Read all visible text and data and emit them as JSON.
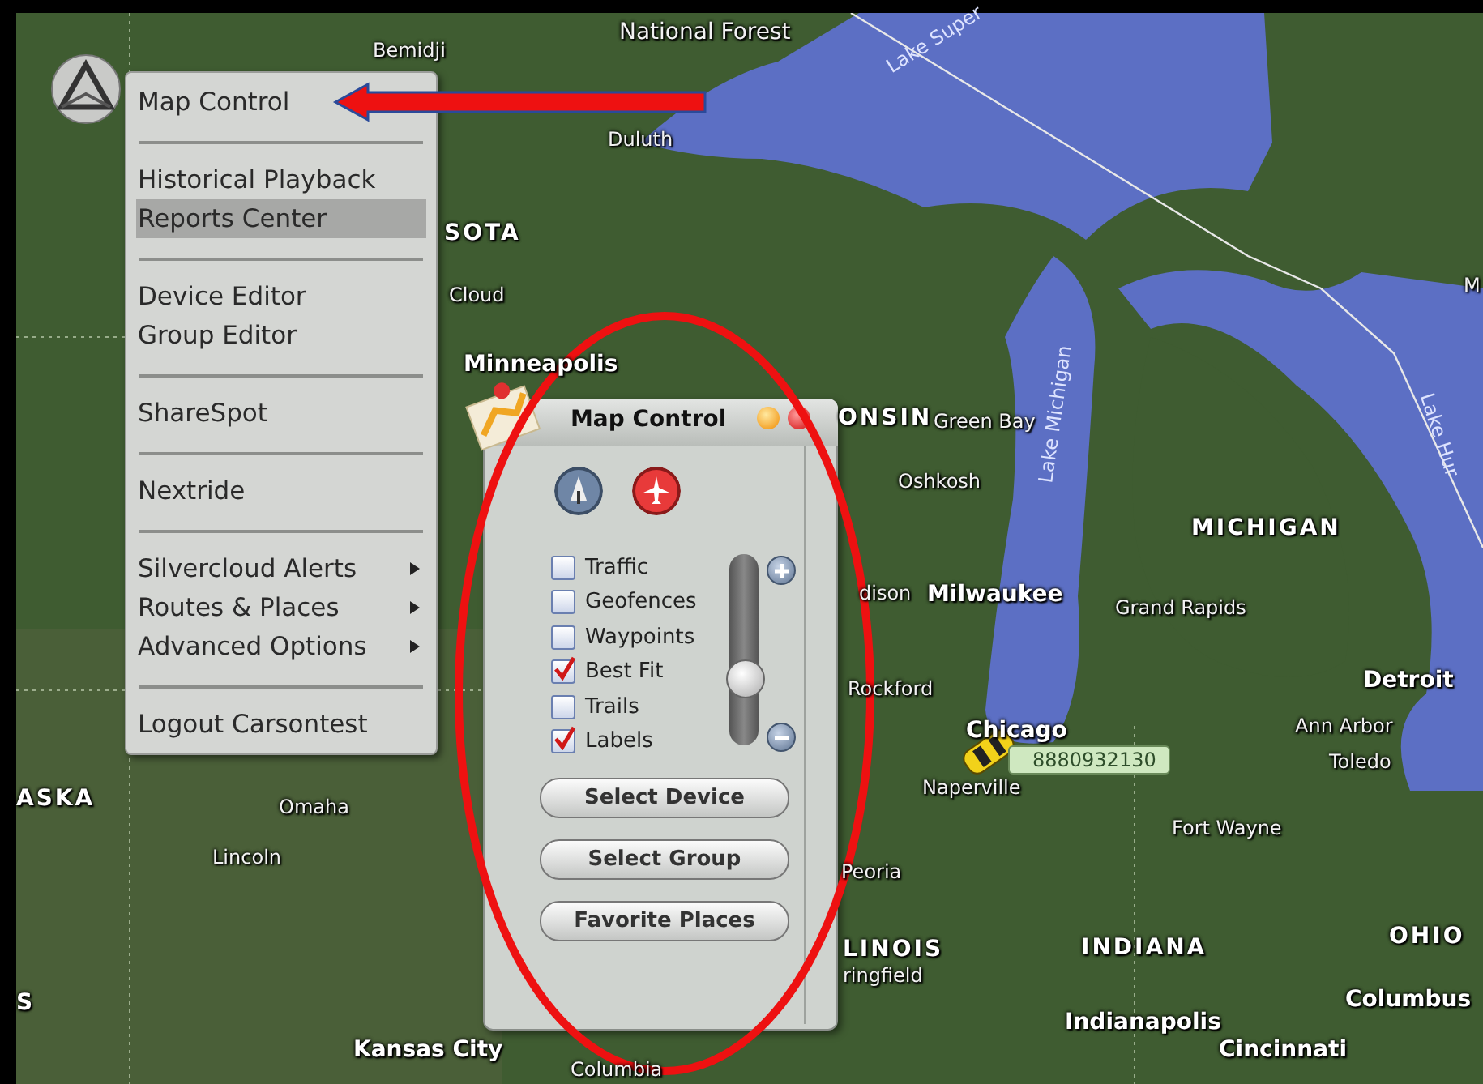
{
  "map": {
    "labels": [
      {
        "text": "National Forest",
        "kind": "region"
      },
      {
        "text": "Bemidji",
        "kind": "town"
      },
      {
        "text": "Lake Super",
        "kind": "water"
      },
      {
        "text": "Duluth",
        "kind": "town"
      },
      {
        "text": "SOTA",
        "kind": "state"
      },
      {
        "text": "Cloud",
        "kind": "town"
      },
      {
        "text": "Minneapolis",
        "kind": "city"
      },
      {
        "text": "ONSIN",
        "kind": "state"
      },
      {
        "text": "Green Bay",
        "kind": "town"
      },
      {
        "text": "Oshkosh",
        "kind": "town"
      },
      {
        "text": "M",
        "kind": "town"
      },
      {
        "text": "Lake Michigan",
        "kind": "water"
      },
      {
        "text": "Lake Hur",
        "kind": "water"
      },
      {
        "text": "MICHIGAN",
        "kind": "state"
      },
      {
        "text": "dison",
        "kind": "town"
      },
      {
        "text": "Milwaukee",
        "kind": "city"
      },
      {
        "text": "Grand Rapids",
        "kind": "town"
      },
      {
        "text": "Rockford",
        "kind": "town"
      },
      {
        "text": "Chicago",
        "kind": "city"
      },
      {
        "text": "Naperville",
        "kind": "town"
      },
      {
        "text": "Detroit",
        "kind": "city"
      },
      {
        "text": "Ann Arbor",
        "kind": "town"
      },
      {
        "text": "Toledo",
        "kind": "town"
      },
      {
        "text": "Fort Wayne",
        "kind": "town"
      },
      {
        "text": "Peoria",
        "kind": "town"
      },
      {
        "text": "LINOIS",
        "kind": "state"
      },
      {
        "text": "ringfield",
        "kind": "town"
      },
      {
        "text": "INDIANA",
        "kind": "state"
      },
      {
        "text": "OHIO",
        "kind": "state"
      },
      {
        "text": "Columbus",
        "kind": "city"
      },
      {
        "text": "Indianapolis",
        "kind": "city"
      },
      {
        "text": "Cincinnati",
        "kind": "city"
      },
      {
        "text": "ASKA",
        "kind": "state"
      },
      {
        "text": "Omaha",
        "kind": "town"
      },
      {
        "text": "Lincoln",
        "kind": "town"
      },
      {
        "text": "S",
        "kind": "state"
      },
      {
        "text": "Kansas City",
        "kind": "city"
      },
      {
        "text": "Columbia",
        "kind": "town"
      }
    ],
    "vehicle": {
      "label": "8880932130"
    }
  },
  "menu": {
    "groups": [
      [
        {
          "label": "Map Control",
          "selected": false,
          "submenu": false
        }
      ],
      [
        {
          "label": "Historical Playback",
          "selected": false,
          "submenu": false
        },
        {
          "label": "Reports Center",
          "selected": true,
          "submenu": false
        }
      ],
      [
        {
          "label": "Device Editor",
          "selected": false,
          "submenu": false
        },
        {
          "label": "Group Editor",
          "selected": false,
          "submenu": false
        }
      ],
      [
        {
          "label": "ShareSpot",
          "selected": false,
          "submenu": false
        }
      ],
      [
        {
          "label": "Nextride",
          "selected": false,
          "submenu": false
        }
      ],
      [
        {
          "label": "Silvercloud Alerts",
          "selected": false,
          "submenu": true
        },
        {
          "label": "Routes & Places",
          "selected": false,
          "submenu": true
        },
        {
          "label": "Advanced Options",
          "selected": false,
          "submenu": true
        }
      ],
      [
        {
          "label": "Logout Carsontest",
          "selected": false,
          "submenu": false
        }
      ]
    ]
  },
  "panel": {
    "title": "Map Control",
    "layers": [
      {
        "label": "Traffic",
        "checked": false
      },
      {
        "label": "Geofences",
        "checked": false
      },
      {
        "label": "Waypoints",
        "checked": false
      },
      {
        "label": "Best Fit",
        "checked": true
      },
      {
        "label": "Trails",
        "checked": false
      },
      {
        "label": "Labels",
        "checked": true
      }
    ],
    "zoom": {
      "level": 0.3
    },
    "buttons": [
      "Select Device",
      "Select Group",
      "Favorite Places"
    ]
  }
}
